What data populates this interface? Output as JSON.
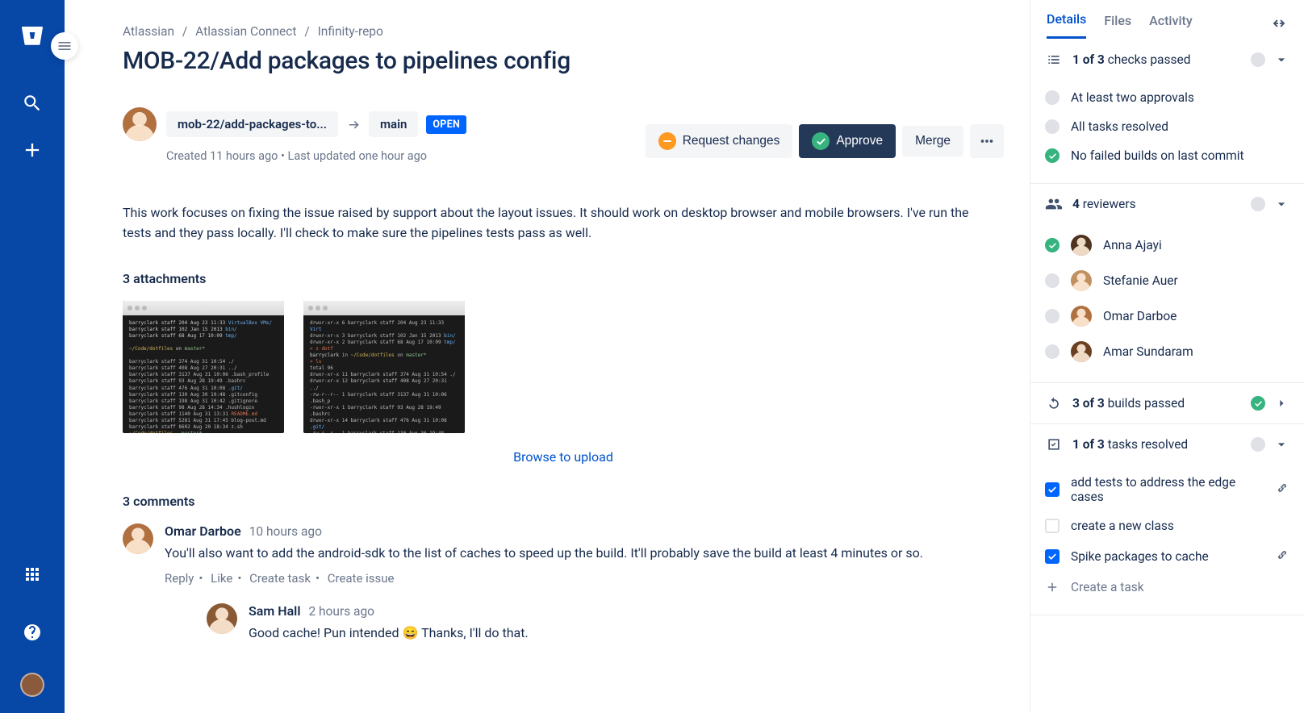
{
  "breadcrumb": {
    "org": "Atlassian",
    "project": "Atlassian Connect",
    "repo": "Infinity-repo"
  },
  "title": "MOB-22/Add packages to pipelines config",
  "branch": {
    "source": "mob-22/add-packages-to...",
    "target": "main",
    "status": "OPEN"
  },
  "timestamps": "Created 11 hours ago • Last updated one hour ago",
  "actions": {
    "request_changes": "Request changes",
    "approve": "Approve",
    "merge": "Merge"
  },
  "description": "This work focuses on fixing the issue raised by support about the layout issues. It should work on desktop browser and mobile browsers. I've run the tests and they pass locally. I'll check to make sure the pipelines tests pass as well.",
  "attachments": {
    "heading": "3 attachments",
    "browse": "Browse to upload"
  },
  "comments": {
    "heading": "3 comments",
    "items": [
      {
        "author": "Omar Darboe",
        "time": "10 hours ago",
        "text": "You'll also want to add the android-sdk to the list of caches to speed up the build. It'll probably save the build at least 4 minutes or so."
      },
      {
        "author": "Sam Hall",
        "time": "2 hours ago",
        "text": "Good cache! Pun intended 😄 Thanks, I'll do that."
      }
    ],
    "actions": {
      "reply": "Reply",
      "like": "Like",
      "create_task": "Create task",
      "create_issue": "Create issue"
    }
  },
  "side": {
    "tabs": {
      "details": "Details",
      "files": "Files",
      "activity": "Activity"
    },
    "checks": {
      "summary_bold": "1 of 3",
      "summary_rest": "checks passed",
      "items": [
        {
          "label": "At least two approvals",
          "ok": false
        },
        {
          "label": "All tasks resolved",
          "ok": false
        },
        {
          "label": "No failed builds on last commit",
          "ok": true
        }
      ]
    },
    "reviewers": {
      "count": "4",
      "label": "reviewers",
      "items": [
        {
          "name": "Anna Ajayi",
          "approved": true
        },
        {
          "name": "Stefanie Auer",
          "approved": false
        },
        {
          "name": "Omar Darboe",
          "approved": false
        },
        {
          "name": "Amar Sundaram",
          "approved": false
        }
      ]
    },
    "builds": {
      "bold": "3 of 3",
      "rest": "builds passed"
    },
    "tasks": {
      "bold": "1 of 3",
      "rest": "tasks resolved",
      "items": [
        {
          "label": "add tests to address the edge cases",
          "done": true,
          "link": true
        },
        {
          "label": "create a new class",
          "done": false,
          "link": false
        },
        {
          "label": "Spike packages to cache",
          "done": true,
          "link": true
        }
      ],
      "create": "Create a task"
    }
  }
}
